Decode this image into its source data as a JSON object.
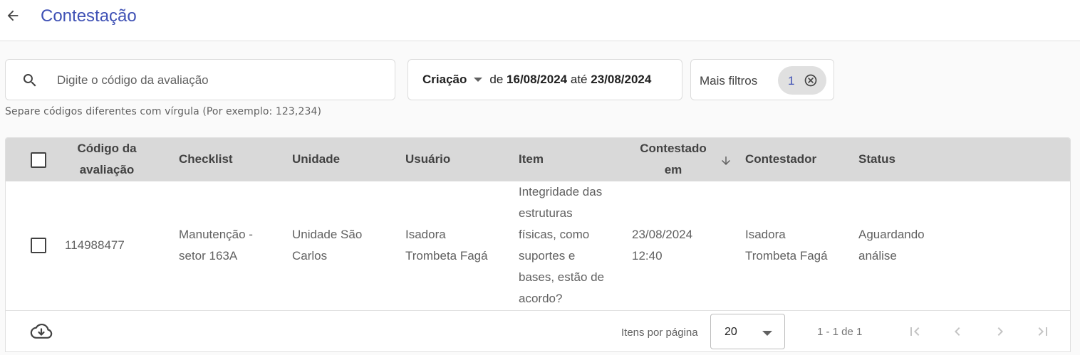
{
  "header": {
    "title": "Contestação"
  },
  "search": {
    "placeholder": "Digite o código da avaliação",
    "value": "",
    "hint": "Separe códigos diferentes com vírgula (Por exemplo: 123,234)"
  },
  "date_filter": {
    "field": "Criação",
    "from_label": "de",
    "from_date": "16/08/2024",
    "to_label": "até",
    "to_date": "23/08/2024"
  },
  "more_filters": {
    "label": "Mais filtros",
    "count": "1"
  },
  "table": {
    "columns": [
      {
        "line1": "Código da",
        "line2": "avaliação"
      },
      {
        "label": "Checklist"
      },
      {
        "label": "Unidade"
      },
      {
        "label": "Usuário"
      },
      {
        "label": "Item"
      },
      {
        "line1": "Contestado",
        "line2": "em"
      },
      {
        "label": "Contestador"
      },
      {
        "label": "Status"
      }
    ],
    "rows": [
      {
        "code": "114988477",
        "checklist": [
          "Manutenção -",
          "setor 163A"
        ],
        "unit": [
          "Unidade São",
          "Carlos"
        ],
        "user": [
          "Isadora",
          "Trombeta Fagá"
        ],
        "item": [
          "Integridade das",
          "estruturas",
          "físicas, como",
          "suportes e",
          "bases, estão de",
          "acordo?"
        ],
        "contested_at": [
          "23/08/2024",
          "12:40"
        ],
        "contester": [
          "Isadora",
          "Trombeta Fagá"
        ],
        "status": [
          "Aguardando",
          "análise"
        ]
      }
    ]
  },
  "pagination": {
    "per_page_label": "Itens por página",
    "per_page_value": "20",
    "range": "1 - 1 de 1"
  },
  "colors": {
    "accent": "#3f51b5",
    "header_bg": "#d9d9d9"
  }
}
